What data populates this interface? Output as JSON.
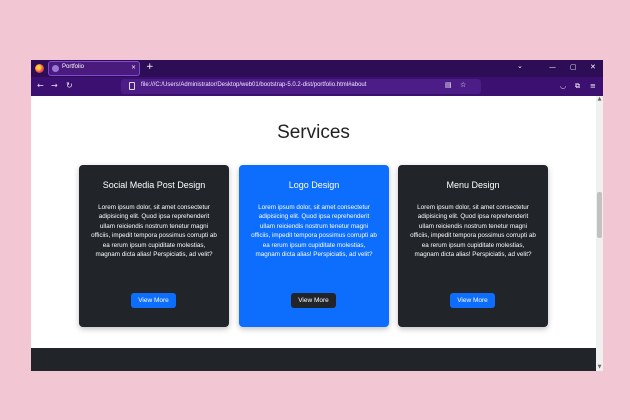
{
  "browser": {
    "tab_title": "Portfolio",
    "tab_close": "×",
    "new_tab": "+",
    "tab_list": "⌄",
    "minimize": "—",
    "maximize": "▢",
    "close": "✕",
    "back": "←",
    "forward": "→",
    "reload": "↻",
    "url": "file:///C:/Users/Administrator/Desktop/web01/bootstrap-5.0.2-dist/portfolio.html#about",
    "reader": "▤",
    "bookmark": "☆",
    "pocket": "◡",
    "extensions": "⧉",
    "menu": "≡"
  },
  "page": {
    "section_title": "Services",
    "cards": [
      {
        "title": "Social Media Post Design",
        "text": "Lorem ipsum dolor, sit amet consectetur adipisicing elit. Quod ipsa reprehenderit ullam reiciendis nostrum tenetur magni officiis, impedit tempora possimus corrupti ab ea rerum ipsum cupiditate molestias, magnam dicta alias! Perspiciatis, ad velit?",
        "button": "View More"
      },
      {
        "title": "Logo Design",
        "text": "Lorem ipsum dolor, sit amet consectetur adipisicing elit. Quod ipsa reprehenderit ullam reiciendis nostrum tenetur magni officiis, impedit tempora possimus corrupti ab ea rerum ipsum cupiditate molestias, magnam dicta alias! Perspiciatis, ad velit?",
        "button": "View More"
      },
      {
        "title": "Menu Design",
        "text": "Lorem ipsum dolor, sit amet consectetur adipisicing elit. Quod ipsa reprehenderit ullam reiciendis nostrum tenetur magni officiis, impedit tempora possimus corrupti ab ea rerum ipsum cupiditate molestias, magnam dicta alias! Perspiciatis, ad velit?",
        "button": "View More"
      }
    ]
  },
  "colors": {
    "background": "#f3c6d3",
    "card_dark": "#212529",
    "card_blue": "#0d6efd",
    "browser_chrome": "#2d0d55"
  },
  "icons": {
    "browser_logo": "firefox-icon",
    "url_page": "file-icon"
  }
}
